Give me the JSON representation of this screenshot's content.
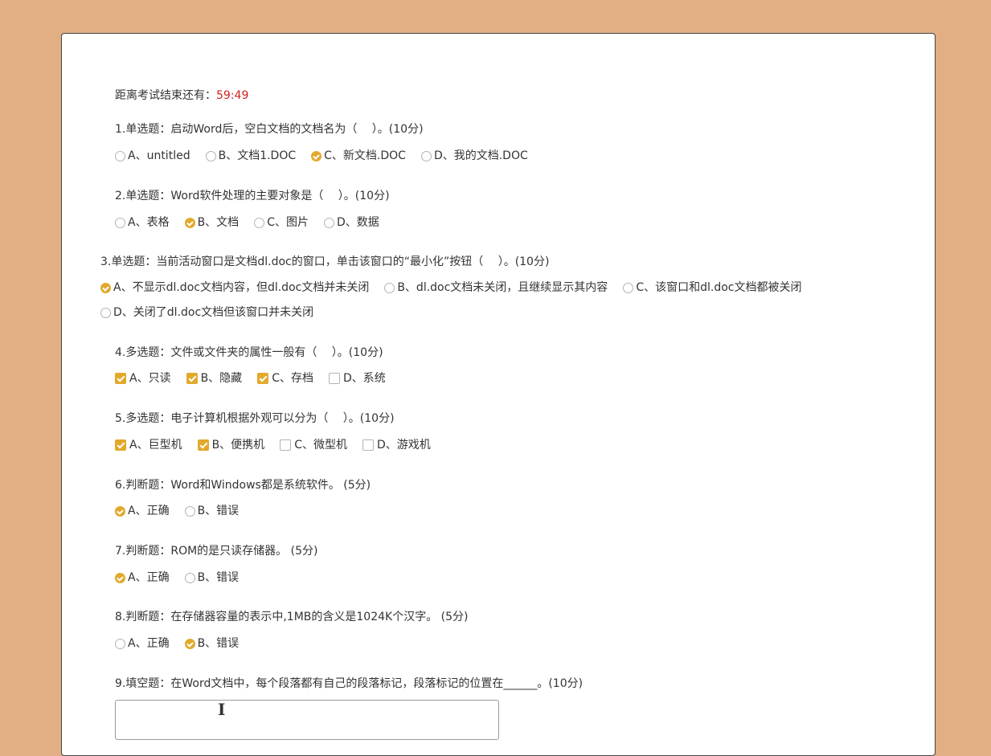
{
  "timer": {
    "label": "距离考试结束还有：",
    "value": "59:49"
  },
  "questions": [
    {
      "title": "1.单选题：启动Word后，空白文档的文档名为（　 ）。(10分)",
      "options": [
        {
          "text": "A、untitled",
          "checked": false
        },
        {
          "text": "B、文档1.DOC",
          "checked": false
        },
        {
          "text": "C、新文档.DOC",
          "checked": true
        },
        {
          "text": "D、我的文档.DOC",
          "checked": false
        }
      ]
    },
    {
      "title": "2.单选题：Word软件处理的主要对象是（　 ）。(10分)",
      "options": [
        {
          "text": "A、表格",
          "checked": false
        },
        {
          "text": "B、文档",
          "checked": true
        },
        {
          "text": "C、图片",
          "checked": false
        },
        {
          "text": "D、数据",
          "checked": false
        }
      ]
    },
    {
      "title": "3.单选题：当前活动窗口是文档dl.doc的窗口，单击该窗口的“最小化”按钮（　 ）。(10分)",
      "options": [
        {
          "text": "A、不显示dl.doc文档内容，但dl.doc文档并未关闭",
          "checked": true
        },
        {
          "text": "B、dl.doc文档未关闭，且继续显示其内容",
          "checked": false
        },
        {
          "text": "C、该窗口和dl.doc文档都被关闭",
          "checked": false
        },
        {
          "text": "D、关闭了dl.doc文档但该窗口并未关闭",
          "checked": false
        }
      ]
    },
    {
      "title": "4.多选题：文件或文件夹的属性一般有（　 ）。(10分)",
      "options": [
        {
          "text": "A、只读",
          "checked": true
        },
        {
          "text": "B、隐藏",
          "checked": true
        },
        {
          "text": "C、存档",
          "checked": true
        },
        {
          "text": "D、系统",
          "checked": false
        }
      ]
    },
    {
      "title": "5.多选题：电子计算机根据外观可以分为（　 ）。(10分)",
      "options": [
        {
          "text": "A、巨型机",
          "checked": true
        },
        {
          "text": "B、便携机",
          "checked": true
        },
        {
          "text": "C、微型机",
          "checked": false
        },
        {
          "text": "D、游戏机",
          "checked": false
        }
      ]
    },
    {
      "title": "6.判断题：Word和Windows都是系统软件。 (5分)",
      "options": [
        {
          "text": "A、正确",
          "checked": true
        },
        {
          "text": "B、错误",
          "checked": false
        }
      ]
    },
    {
      "title": "7.判断题：ROM的是只读存储器。 (5分)",
      "options": [
        {
          "text": "A、正确",
          "checked": true
        },
        {
          "text": "B、错误",
          "checked": false
        }
      ]
    },
    {
      "title": "8.判断题：在存储器容量的表示中,1MB的含义是1024K个汉字。 (5分)",
      "options": [
        {
          "text": "A、正确",
          "checked": false
        },
        {
          "text": "B、错误",
          "checked": true
        }
      ]
    },
    {
      "title": "9.填空题：在Word文档中，每个段落都有自己的段落标记，段落标记的位置在______。(10分)"
    }
  ],
  "colors": {
    "accent": "#e2a92c",
    "timer": "#d02020",
    "background": "#e2ae84"
  },
  "icons": {
    "cursor": "text-cursor-icon"
  }
}
